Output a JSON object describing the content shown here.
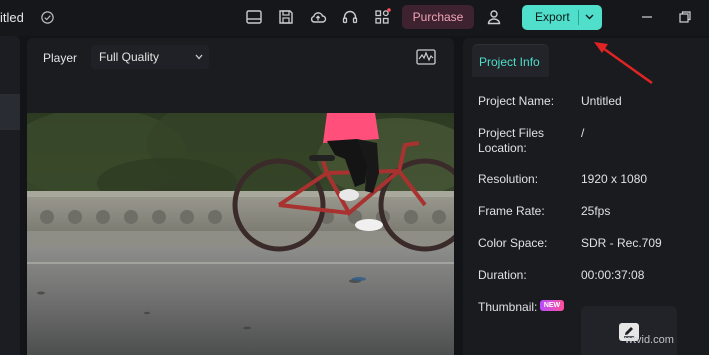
{
  "window": {
    "title": "itled"
  },
  "toolbar": {
    "icons": [
      "layout-icon",
      "save-icon",
      "cloud-upload-icon",
      "headset-icon",
      "grid-apps-icon",
      "user-icon"
    ],
    "purchase_label": "Purchase",
    "export_label": "Export",
    "accent_color": "#4fdfca",
    "purchase_color": "#f2a4b6"
  },
  "player": {
    "label": "Player",
    "quality": "Full Quality"
  },
  "project_info": {
    "tab_label": "Project Info",
    "rows": [
      {
        "label": "Project Name:",
        "value": "Untitled"
      },
      {
        "label": "Project Files Location:",
        "value": "/"
      },
      {
        "label": "Resolution:",
        "value": "1920 x 1080"
      },
      {
        "label": "Frame Rate:",
        "value": "25fps"
      },
      {
        "label": "Color Space:",
        "value": "SDR - Rec.709"
      },
      {
        "label": "Duration:",
        "value": "00:00:37:08"
      }
    ],
    "thumbnail_label": "Thumbnail:",
    "new_badge": "NEW"
  },
  "watermark": "wtvid.com"
}
